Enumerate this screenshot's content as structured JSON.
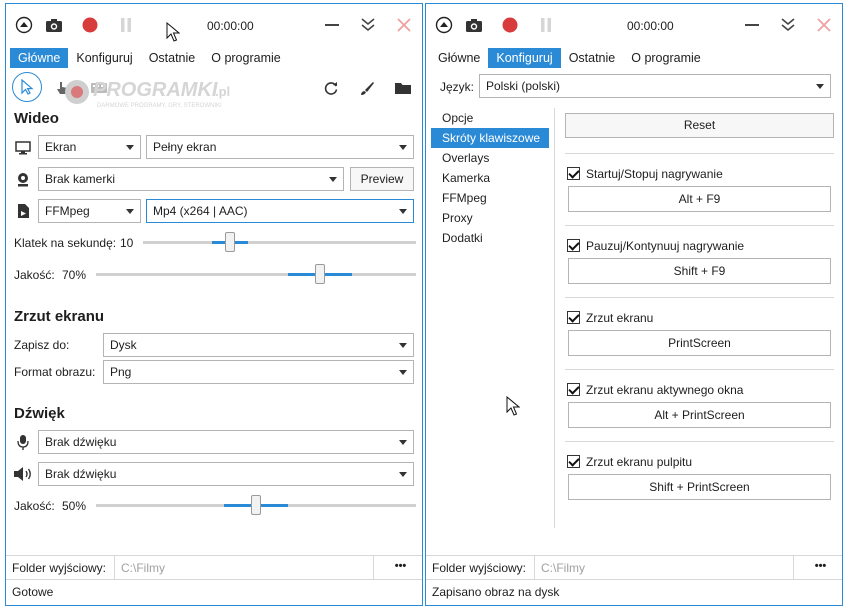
{
  "left": {
    "timer": "00:00:00",
    "tabs": [
      "Główne",
      "Konfiguruj",
      "Ostatnie",
      "O programie"
    ],
    "watermark": {
      "title": "PROGRAMKI",
      "suffix": ".pl",
      "subtitle": "DARMOWE PROGRAMY, GRY, STEROWNIKI"
    },
    "video": {
      "heading": "Wideo",
      "source": "Ekran",
      "screen": "Pełny ekran",
      "camera": "Brak kamerki",
      "preview_label": "Preview",
      "encoder": "FFMpeg",
      "format": "Mp4 (x264 | AAC)",
      "fps_label": "Klatek na sekundę:",
      "fps_value": "10",
      "fps_fraction": 0.32,
      "quality_label": "Jakość:",
      "quality_value": "70%",
      "quality_fraction": 0.7
    },
    "screenshot": {
      "heading": "Zrzut ekranu",
      "save_label": "Zapisz do:",
      "save_value": "Dysk",
      "format_label": "Format obrazu:",
      "format_value": "Png"
    },
    "audio": {
      "heading": "Dźwięk",
      "mic": "Brak dźwięku",
      "speaker": "Brak dźwięku",
      "quality_label": "Jakość:",
      "quality_value": "50%",
      "quality_fraction": 0.5
    },
    "output_label": "Folder wyjściowy:",
    "output_placeholder": "C:\\Filmy",
    "more_label": "•••",
    "status": "Gotowe"
  },
  "right": {
    "timer": "00:00:00",
    "tabs": [
      "Główne",
      "Konfiguruj",
      "Ostatnie",
      "O programie"
    ],
    "language_label": "Język:",
    "language_value": "Polski (polski)",
    "nav": [
      "Opcje",
      "Skróty klawiszowe",
      "Overlays",
      "Kamerka",
      "FFMpeg",
      "Proxy",
      "Dodatki"
    ],
    "reset_label": "Reset",
    "hotkeys": [
      {
        "label": "Startuj/Stopuj nagrywanie",
        "key": "Alt + F9"
      },
      {
        "label": "Pauzuj/Kontynuuj nagrywanie",
        "key": "Shift + F9"
      },
      {
        "label": "Zrzut ekranu",
        "key": "PrintScreen"
      },
      {
        "label": "Zrzut ekranu aktywnego okna",
        "key": "Alt + PrintScreen"
      },
      {
        "label": "Zrzut ekranu pulpitu",
        "key": "Shift + PrintScreen"
      }
    ],
    "output_label": "Folder wyjściowy:",
    "output_placeholder": "C:\\Filmy",
    "more_label": "•••",
    "status": "Zapisano obraz na dysk"
  },
  "colors": {
    "accent": "#2b8ad6",
    "record": "#d83b3b",
    "close": "#e05050"
  }
}
